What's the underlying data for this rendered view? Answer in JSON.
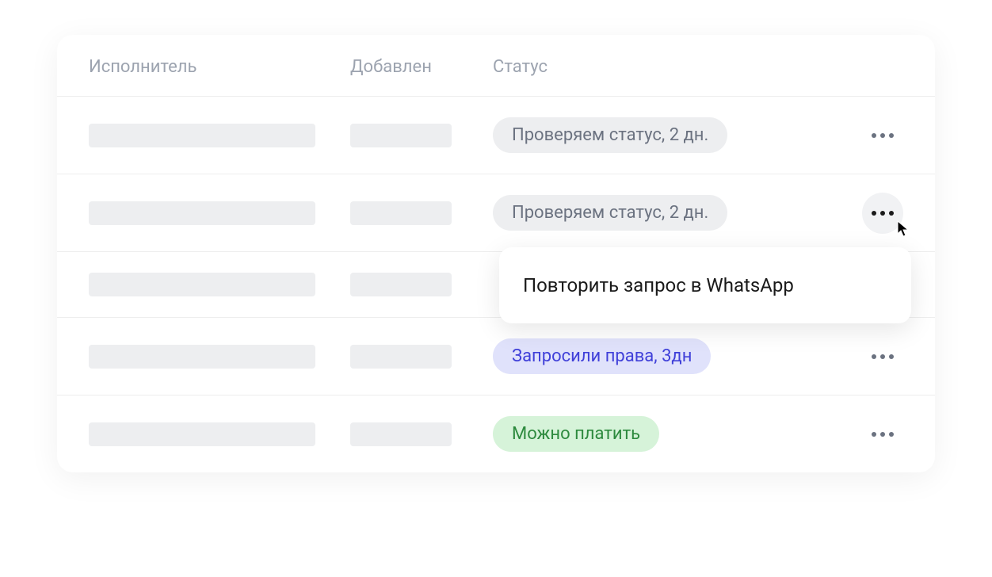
{
  "headers": {
    "executor": "Исполнитель",
    "added": "Добавлен",
    "status": "Статус"
  },
  "rows": [
    {
      "status_text": "Проверяем статус, 2 дн.",
      "status_variant": "gray",
      "hover": false
    },
    {
      "status_text": "Проверяем статус, 2 дн.",
      "status_variant": "gray",
      "hover": true
    },
    {
      "status_text": "",
      "status_variant": "none",
      "hover": false
    },
    {
      "status_text": "Запросили права, 3дн",
      "status_variant": "blue",
      "hover": false
    },
    {
      "status_text": "Можно платить",
      "status_variant": "green",
      "hover": false
    }
  ],
  "dropdown": {
    "item": "Повторить запрос в WhatsApp"
  }
}
